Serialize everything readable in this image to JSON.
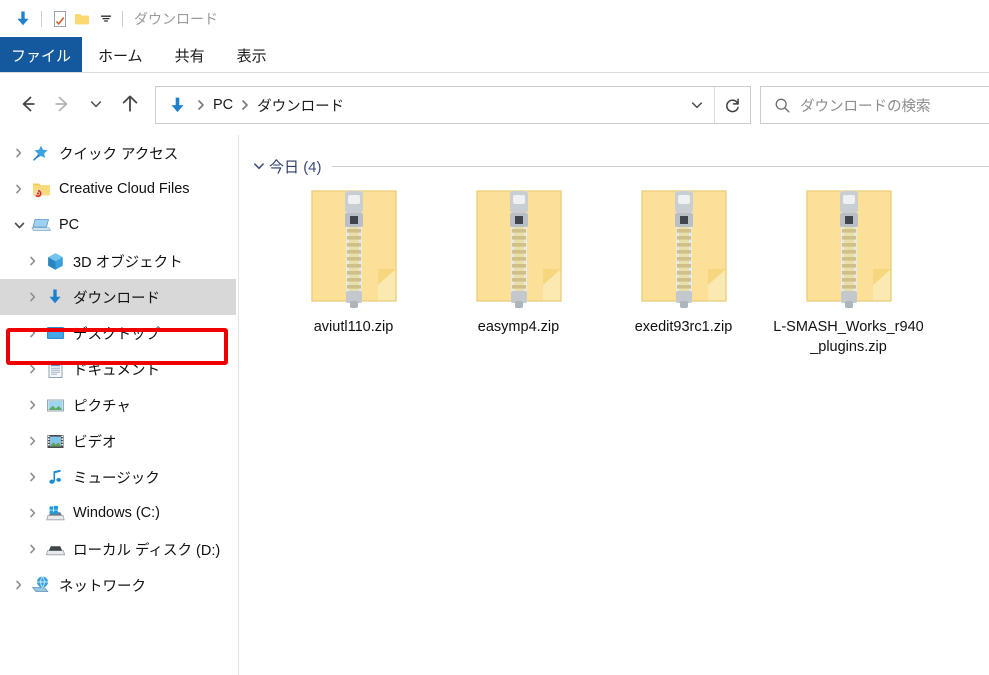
{
  "window": {
    "title": "ダウンロード"
  },
  "quick_access_toolbar": {
    "items": [
      {
        "icon": "download-arrow-icon",
        "label": "ダウンロード"
      },
      {
        "icon": "properties-icon",
        "label": "プロパティ"
      },
      {
        "icon": "new-folder-icon",
        "label": "新しいフォルダー"
      },
      {
        "icon": "chevron-down-icon",
        "label": "クイック アクセス ツール バーのカスタマイズ"
      }
    ]
  },
  "ribbon": {
    "tabs": [
      {
        "label": "ファイル",
        "active": true
      },
      {
        "label": "ホーム",
        "active": false
      },
      {
        "label": "共有",
        "active": false
      },
      {
        "label": "表示",
        "active": false
      }
    ],
    "active_tab_bg": "#14599e",
    "active_tab_fg": "#ffffff"
  },
  "navigation": {
    "back_label": "戻る",
    "forward_label": "進む",
    "recent_label": "最近表示した場所",
    "up_label": "上へ"
  },
  "address_bar": {
    "crumbs": [
      {
        "label": "PC"
      },
      {
        "label": "ダウンロード"
      }
    ],
    "icon": "download-arrow-icon",
    "separator": "›",
    "dropdown_label": "以前の場所",
    "refresh_label": "最新の情報に更新"
  },
  "search": {
    "placeholder": "ダウンロードの検索",
    "icon": "search-icon"
  },
  "sidebar": {
    "items": [
      {
        "label": "クイック アクセス",
        "icon": "quick-access-star-icon",
        "indent": 0,
        "expanded": false,
        "selected": false
      },
      {
        "label": "Creative Cloud Files",
        "icon": "creative-cloud-folder-icon",
        "indent": 0,
        "expanded": false,
        "selected": false
      },
      {
        "label": "PC",
        "icon": "pc-icon",
        "indent": 0,
        "expanded": true,
        "selected": false
      },
      {
        "label": "3D オブジェクト",
        "icon": "3d-objects-icon",
        "indent": 1,
        "expanded": false,
        "selected": false
      },
      {
        "label": "ダウンロード",
        "icon": "download-arrow-icon",
        "indent": 1,
        "expanded": false,
        "selected": true
      },
      {
        "label": "デスクトップ",
        "icon": "desktop-icon",
        "indent": 1,
        "expanded": false,
        "selected": false
      },
      {
        "label": "ドキュメント",
        "icon": "documents-icon",
        "indent": 1,
        "expanded": false,
        "selected": false
      },
      {
        "label": "ピクチャ",
        "icon": "pictures-icon",
        "indent": 1,
        "expanded": false,
        "selected": false
      },
      {
        "label": "ビデオ",
        "icon": "videos-icon",
        "indent": 1,
        "expanded": false,
        "selected": false
      },
      {
        "label": "ミュージック",
        "icon": "music-note-icon",
        "indent": 1,
        "expanded": false,
        "selected": false
      },
      {
        "label": "Windows (C:)",
        "icon": "windows-drive-icon",
        "indent": 1,
        "expanded": false,
        "selected": false
      },
      {
        "label": "ローカル ディスク (D:)",
        "icon": "local-disk-icon",
        "indent": 1,
        "expanded": false,
        "selected": false
      },
      {
        "label": "ネットワーク",
        "icon": "network-icon",
        "indent": 0,
        "expanded": false,
        "selected": false
      }
    ],
    "highlight_color": "#ee0000",
    "selected_row_bg": "#d8d8d8"
  },
  "content": {
    "group": {
      "label": "今日",
      "count": "(4)",
      "expanded": true
    },
    "files": [
      {
        "name": "aviutl110.zip",
        "icon": "zip-folder-icon"
      },
      {
        "name": "easymp4.zip",
        "icon": "zip-folder-icon"
      },
      {
        "name": "exedit93rc1.zip",
        "icon": "zip-folder-icon"
      },
      {
        "name": "L-SMASH_Works_r940_plugins.zip",
        "icon": "zip-folder-icon"
      }
    ]
  }
}
